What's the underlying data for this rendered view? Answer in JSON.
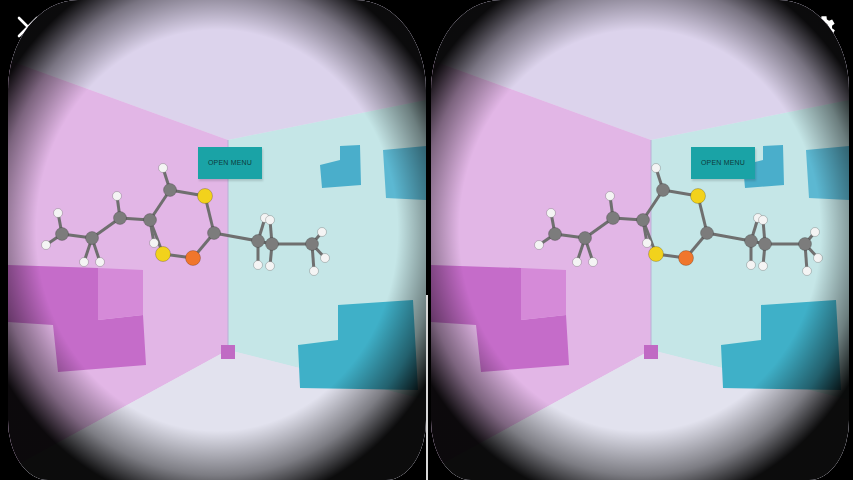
{
  "eyes": [
    {
      "side": "left",
      "menu_button": "OPEN MENU"
    },
    {
      "side": "right",
      "menu_button": "OPEN MENU"
    }
  ],
  "molecule": {
    "atoms": [
      {
        "kind": "carbon",
        "color": "#7c7c7c"
      },
      {
        "kind": "carbon",
        "color": "#7c7c7c"
      },
      {
        "kind": "carbon",
        "color": "#7c7c7c"
      },
      {
        "kind": "carbon",
        "color": "#7c7c7c"
      },
      {
        "kind": "carbon",
        "color": "#7c7c7c"
      },
      {
        "kind": "sulfur",
        "color": "#f2d21c"
      },
      {
        "kind": "carbon",
        "color": "#7c7c7c"
      },
      {
        "kind": "oxygen",
        "color": "#f0762c"
      },
      {
        "kind": "sulfur",
        "color": "#f2d21c"
      },
      {
        "kind": "carbon",
        "color": "#7c7c7c"
      },
      {
        "kind": "carbon",
        "color": "#7c7c7c"
      },
      {
        "kind": "carbon",
        "color": "#7c7c7c"
      },
      {
        "kind": "hydrogen",
        "color": "#f4f4f4"
      },
      {
        "kind": "hydrogen",
        "color": "#f4f4f4"
      },
      {
        "kind": "hydrogen",
        "color": "#f4f4f4"
      },
      {
        "kind": "hydrogen",
        "color": "#f4f4f4"
      },
      {
        "kind": "hydrogen",
        "color": "#f4f4f4"
      },
      {
        "kind": "hydrogen",
        "color": "#f4f4f4"
      },
      {
        "kind": "hydrogen",
        "color": "#f4f4f4"
      },
      {
        "kind": "hydrogen",
        "color": "#f4f4f4"
      },
      {
        "kind": "hydrogen",
        "color": "#f4f4f4"
      },
      {
        "kind": "hydrogen",
        "color": "#f4f4f4"
      },
      {
        "kind": "hydrogen",
        "color": "#f4f4f4"
      },
      {
        "kind": "hydrogen",
        "color": "#f4f4f4"
      },
      {
        "kind": "hydrogen",
        "color": "#f4f4f4"
      },
      {
        "kind": "hydrogen",
        "color": "#f4f4f4"
      }
    ]
  }
}
